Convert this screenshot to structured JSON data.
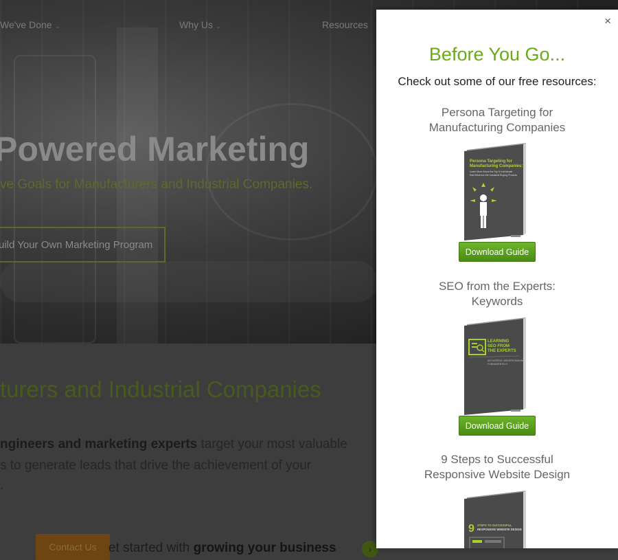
{
  "nav": {
    "items": [
      {
        "label": "We've Done"
      },
      {
        "label": "Why Us"
      },
      {
        "label": "Resources"
      }
    ]
  },
  "hero": {
    "title": "Powered Marketing",
    "subtitle": "ve Goals for Manufacturers and Industrial Companies.",
    "cta": "uild Your Own Marketing Program"
  },
  "lower": {
    "title": "turers and Industrial Companies",
    "line1_bold": "ngineers and marketing experts",
    "line1_rest": " target your most valuable",
    "line2": "s to generate leads that drive the achievement of your",
    "line3": ".",
    "contact_label": "Contact Us",
    "get_started_pre": "et started with ",
    "get_started_bold": "growing your business"
  },
  "modal": {
    "close": "×",
    "title": "Before You Go...",
    "subtitle": "Check out some of our free resources:",
    "resources": [
      {
        "title_line1": "Persona Targeting for",
        "title_line2": "Manufacturing Companies",
        "cover_title": "Persona Targeting for Manufacturing Companies:",
        "cover_sub": "Learn More About the Top 5 Individuals that Influence the Industrial Buying Process",
        "button": "Download Guide"
      },
      {
        "title_line1": "SEO from the Experts:",
        "title_line2": "Keywords",
        "cover_title": "LEARNING SEO FROM THE EXPERTS",
        "cover_sub": "KEYWORDS: UNDERSTANDING FUNDAMENTALS",
        "button": "Download Guide"
      },
      {
        "title_line1": "9 Steps to Successful",
        "title_line2": "Responsive Website Design",
        "cover_title": "STEPS TO SUCCESSFUL RESPONSIVE WEBSITE DESIGN",
        "cover_num": "9"
      }
    ]
  },
  "colors": {
    "accent_green": "#6aaa1a",
    "button_green": "#5aa020",
    "book_gray": "#4a4a4a"
  }
}
